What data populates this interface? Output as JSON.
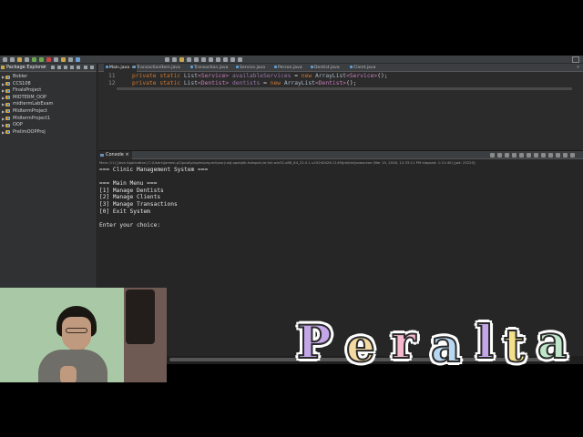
{
  "colors": {
    "accent_keyword": "#cc7832",
    "generic_type": "#c77dbb",
    "field": "#9876aa",
    "java_icon": "#5f9fd6",
    "project_icon": "#d4a84b"
  },
  "explorer": {
    "title": "Package Explorer",
    "close": "×",
    "projects": [
      {
        "name": "Bobler",
        "icon": "java-project-icon"
      },
      {
        "name": "CCS108",
        "icon": "java-project-icon"
      },
      {
        "name": "FinalsProject",
        "icon": "java-project-icon"
      },
      {
        "name": "MIDTERM_OOP",
        "icon": "java-project-icon"
      },
      {
        "name": "midtermLabExam",
        "icon": "java-project-icon"
      },
      {
        "name": "MidtermProject",
        "icon": "java-project-icon"
      },
      {
        "name": "MidtermProject1",
        "icon": "java-project-icon"
      },
      {
        "name": "OOP",
        "icon": "java-project-icon"
      },
      {
        "name": "PrelimOOPProj",
        "icon": "java-project-icon"
      }
    ]
  },
  "editor": {
    "tabs": [
      "Main.java",
      "TransactionItem.java",
      "Transaction.java",
      "Service.java",
      "Person.java",
      "Dentist.java",
      "Client.java"
    ],
    "active_close": "×",
    "more": "»",
    "lines": [
      {
        "num": "11",
        "kw": "private static ",
        "type": "List",
        "g1": "<Service>",
        "field": " availableServices",
        "eq": " = ",
        "kw2": "new ",
        "type2": "ArrayList",
        "g2": "<Service>",
        "end": "();"
      },
      {
        "num": "12",
        "kw": "private static ",
        "type": "List",
        "g1": "<Dentist>",
        "field": " dentists",
        "eq": " = ",
        "kw2": "new ",
        "type2": "ArrayList",
        "g2": "<Dentist>",
        "end": "();"
      }
    ]
  },
  "console": {
    "tab": "Console",
    "close": "×",
    "status": "Main (11) [Java Application] C:\\Users\\james\\.p2\\pool\\plugins\\org.eclipse.justj.openjdk.hotspot.jre.full.win32.x86_64_22.0.1.v20240426-1149\\jre\\bin\\javaw.exe  (Mar 15, 2026, 12:33:11 PM elapsed: 1:21:40) [pid: 25220]",
    "output": [
      "=== Clinic Management System ===",
      "",
      "=== Main Menu ===",
      "[1] Manage Dentists",
      "[2] Manage Clients",
      "[3] Manage Transactions",
      "[0] Exit System",
      "",
      "Enter your choice:"
    ]
  },
  "logo": {
    "letters": [
      {
        "char": "P",
        "color": "#c3a6e8"
      },
      {
        "char": "e",
        "color": "#f4d9a1"
      },
      {
        "char": "r",
        "color": "#f6b8cf"
      },
      {
        "char": "a",
        "color": "#b7d7f2"
      },
      {
        "char": "l",
        "color": "#c3a6e8"
      },
      {
        "char": "t",
        "color": "#f4e08a"
      },
      {
        "char": "a",
        "color": "#bfe6c8"
      }
    ]
  }
}
